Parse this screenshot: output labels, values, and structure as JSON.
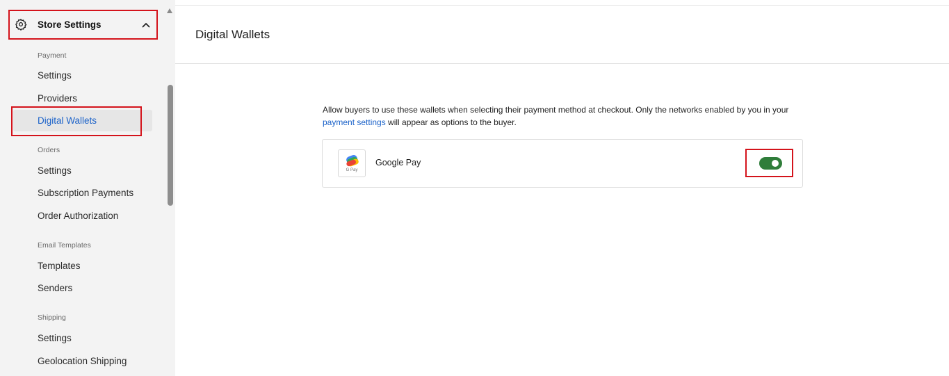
{
  "sidebar": {
    "header": {
      "title": "Store Settings",
      "icon": "gear-icon",
      "expanded": true
    },
    "sections": [
      {
        "title": "Payment",
        "items": [
          "Settings",
          "Providers",
          "Digital Wallets"
        ]
      },
      {
        "title": "Orders",
        "items": [
          "Settings",
          "Subscription Payments",
          "Order Authorization"
        ]
      },
      {
        "title": "Email Templates",
        "items": [
          "Templates",
          "Senders"
        ]
      },
      {
        "title": "Shipping",
        "items": [
          "Settings",
          "Geolocation Shipping"
        ]
      }
    ],
    "active_item": "Digital Wallets"
  },
  "main": {
    "title": "Digital Wallets",
    "description": {
      "part1": "Allow buyers to use these wallets when selecting their payment method at checkout. Only the networks enabled by you in your ",
      "link": "payment settings",
      "part2": " will appear as options to the buyer."
    },
    "wallets": [
      {
        "name": "Google Pay",
        "logo_text": "G Pay",
        "enabled": true
      }
    ]
  },
  "colors": {
    "accent_link": "#1b62c9",
    "toggle_on": "#2f7d3a",
    "highlight_box": "#d4131b"
  }
}
